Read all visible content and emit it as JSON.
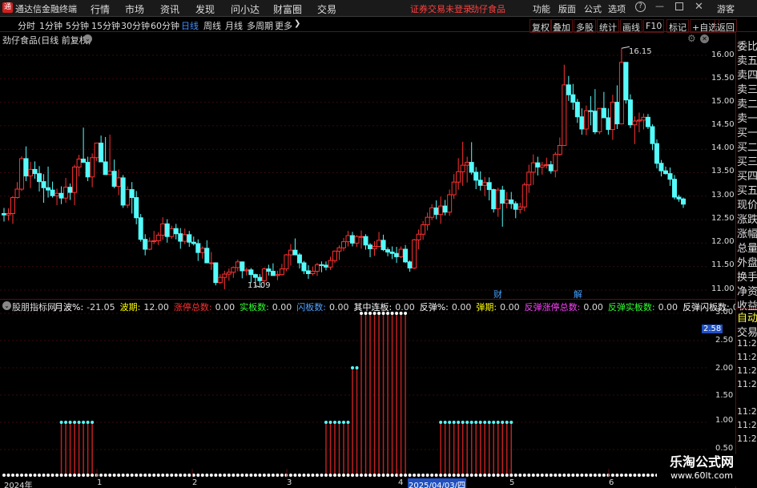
{
  "menubar": {
    "app_title": "通达信金融终端",
    "menus": [
      "行情",
      "市场",
      "资讯",
      "发现",
      "问小达",
      "财富圈",
      "交易"
    ],
    "status_text": "证券交易未登录",
    "stock_name": "劲仔食品",
    "right_menus": [
      "功能",
      "版面",
      "公式",
      "选项"
    ],
    "user": "游客"
  },
  "periods": [
    "分时",
    "1分钟",
    "5分钟",
    "15分钟",
    "30分钟",
    "60分钟",
    "日线",
    "周线",
    "月线",
    "多周期",
    "更多"
  ],
  "active_period": "日线",
  "toolbar_right": [
    "复权",
    "叠加",
    "多股",
    "统计",
    "画线",
    "F10",
    "标记",
    "+自选",
    "返回"
  ],
  "main_chart": {
    "title": "劲仔食品(日线 前复权)",
    "high_label": "16.15",
    "low_label": "11.09",
    "ylabels": [
      "16.00",
      "15.50",
      "15.00",
      "14.50",
      "14.00",
      "13.50",
      "13.00",
      "12.50",
      "12.00",
      "11.50",
      "11.00"
    ],
    "markers": [
      "财",
      "解"
    ]
  },
  "indicator": {
    "name": "股朋指标网",
    "items": [
      {
        "label": "月波%:",
        "value": "-21.05",
        "color": "#ffffff"
      },
      {
        "label": "波期:",
        "value": "12.00",
        "color": "#ffff00"
      },
      {
        "label": "涨停总数:",
        "value": "0.00",
        "color": "#ff3030"
      },
      {
        "label": "实板数:",
        "value": "0.00",
        "color": "#30ff30"
      },
      {
        "label": "闪板数:",
        "value": "0.00",
        "color": "#50a0ff"
      },
      {
        "label": "其中连板:",
        "value": "0.00",
        "color": "#ffffff"
      },
      {
        "label": "反弹%:",
        "value": "0.00",
        "color": "#ffffff"
      },
      {
        "label": "弹期:",
        "value": "0.00",
        "color": "#ffff00"
      },
      {
        "label": "反弹涨停总数:",
        "value": "0.00",
        "color": "#ff40ff"
      },
      {
        "label": "反弹实板数:",
        "value": "0.00",
        "color": "#30ff30"
      },
      {
        "label": "反弹闪板数:",
        "value": "0.00",
        "color": "#ffffff"
      },
      {
        "label": "其中反弹连板:",
        "value": "0.00",
        "color": "#ffffff"
      }
    ],
    "ylabels": [
      "3.00",
      "2.50",
      "2.00",
      "1.50",
      "1.00",
      "0.50"
    ],
    "current_value": "2.58"
  },
  "xaxis": [
    "2024年",
    "1",
    "2",
    "3",
    "4",
    "2025/04/03/四",
    "5",
    "6"
  ],
  "right_panel": [
    "委比",
    "卖五",
    "卖四",
    "卖三",
    "卖二",
    "卖一",
    "买一",
    "买二",
    "买三",
    "买四",
    "买五",
    "现价",
    "涨跌",
    "涨幅",
    "总量",
    "外盘",
    "换手",
    "净资",
    "收益"
  ],
  "right_panel2": [
    "自动",
    "交易"
  ],
  "right_times": [
    "11:26",
    "11:26",
    "11:26",
    "11:26",
    "11:28",
    "11:28",
    "11:28"
  ],
  "watermark": {
    "title": "乐淘公式网",
    "url": "www.60lt.com"
  },
  "colors": {
    "up": "#ff3232",
    "down": "#54fcfc",
    "bar": "#c02020",
    "dot": "#ffffff",
    "dot_cyan": "#54fcfc",
    "accent": "#ff2020"
  },
  "chart_data": {
    "type": "candlestick",
    "ylim": [
      10.85,
      16.35
    ],
    "candles": [
      [
        12.63,
        12.75,
        12.46,
        12.6
      ],
      [
        12.6,
        12.74,
        12.48,
        12.63
      ],
      [
        12.63,
        13.0,
        12.41,
        12.97
      ],
      [
        12.97,
        13.3,
        12.95,
        13.15
      ],
      [
        13.15,
        13.85,
        13.11,
        13.8
      ],
      [
        13.8,
        14.06,
        13.32,
        13.43
      ],
      [
        13.43,
        13.73,
        13.17,
        13.57
      ],
      [
        13.57,
        13.74,
        13.37,
        13.48
      ],
      [
        13.48,
        13.64,
        13.1,
        13.31
      ],
      [
        13.31,
        13.47,
        12.86,
        13.18
      ],
      [
        13.18,
        13.63,
        12.97,
        13.13
      ],
      [
        13.13,
        13.31,
        12.97,
        13.01
      ],
      [
        13.01,
        13.16,
        12.81,
        13.06
      ],
      [
        13.06,
        13.21,
        12.83,
        12.96
      ],
      [
        12.96,
        13.39,
        12.86,
        13.19
      ],
      [
        13.19,
        13.27,
        12.92,
        13.08
      ],
      [
        13.08,
        13.67,
        12.81,
        13.62
      ],
      [
        13.62,
        13.88,
        13.42,
        13.79
      ],
      [
        13.79,
        14.46,
        13.74,
        13.72
      ],
      [
        13.72,
        13.84,
        13.32,
        13.41
      ],
      [
        13.41,
        13.91,
        13.19,
        13.82
      ],
      [
        13.82,
        14.13,
        13.75,
        14.13
      ],
      [
        14.13,
        14.29,
        13.84,
        13.73
      ],
      [
        13.73,
        14.26,
        13.68,
        13.46
      ],
      [
        13.46,
        14.31,
        13.46,
        13.53
      ],
      [
        13.53,
        13.78,
        13.17,
        13.21
      ],
      [
        13.21,
        13.57,
        13.02,
        13.39
      ],
      [
        13.39,
        13.45,
        12.75,
        12.81
      ],
      [
        12.81,
        13.21,
        12.75,
        13.14
      ],
      [
        13.14,
        13.3,
        12.63,
        12.97
      ],
      [
        12.97,
        13.11,
        12.4,
        12.54
      ],
      [
        12.54,
        12.62,
        12.03,
        12.08
      ],
      [
        12.08,
        12.19,
        11.74,
        11.87
      ],
      [
        11.87,
        12.12,
        11.85,
        12.04
      ],
      [
        12.04,
        12.26,
        11.98,
        12.05
      ],
      [
        12.05,
        12.23,
        11.96,
        12.17
      ],
      [
        12.17,
        12.55,
        12.07,
        12.41
      ],
      [
        12.41,
        12.51,
        12.01,
        12.14
      ],
      [
        12.14,
        12.37,
        12.09,
        12.31
      ],
      [
        12.31,
        12.41,
        12.08,
        12.2
      ],
      [
        12.2,
        12.32,
        11.88,
        12.04
      ],
      [
        12.04,
        12.31,
        11.98,
        12.18
      ],
      [
        12.18,
        12.26,
        11.92,
        12.02
      ],
      [
        12.02,
        12.14,
        11.95,
        11.99
      ],
      [
        11.99,
        12.08,
        11.62,
        11.8
      ],
      [
        11.8,
        11.93,
        11.67,
        11.89
      ],
      [
        11.89,
        12.06,
        11.63,
        11.58
      ],
      [
        11.58,
        11.81,
        11.43,
        11.58
      ],
      [
        11.58,
        11.59,
        11.1,
        11.16
      ],
      [
        11.16,
        11.34,
        11.13,
        11.27
      ],
      [
        11.27,
        11.41,
        11.02,
        11.34
      ],
      [
        11.34,
        11.46,
        11.2,
        11.38
      ],
      [
        11.38,
        11.5,
        11.26,
        11.48
      ],
      [
        11.48,
        11.65,
        11.4,
        11.6
      ],
      [
        11.6,
        11.61,
        11.25,
        11.41
      ],
      [
        11.41,
        11.48,
        11.31,
        11.43
      ],
      [
        11.43,
        11.47,
        11.15,
        11.33
      ],
      [
        11.33,
        11.35,
        11.09,
        11.27
      ],
      [
        11.27,
        11.34,
        11.09,
        11.2
      ],
      [
        11.2,
        11.48,
        11.15,
        11.45
      ],
      [
        11.45,
        11.54,
        11.31,
        11.4
      ],
      [
        11.4,
        11.57,
        11.31,
        11.31
      ],
      [
        11.31,
        11.41,
        11.21,
        11.33
      ],
      [
        11.33,
        11.56,
        11.31,
        11.45
      ],
      [
        11.45,
        11.77,
        11.4,
        11.75
      ],
      [
        11.75,
        11.98,
        11.52,
        11.85
      ],
      [
        11.85,
        12.1,
        11.79,
        11.75
      ],
      [
        11.75,
        11.79,
        11.46,
        11.58
      ],
      [
        11.58,
        11.62,
        11.34,
        11.41
      ],
      [
        11.41,
        11.53,
        11.24,
        11.35
      ],
      [
        11.35,
        11.5,
        11.31,
        11.4
      ],
      [
        11.4,
        11.58,
        11.3,
        11.54
      ],
      [
        11.54,
        11.61,
        11.38,
        11.53
      ],
      [
        11.53,
        11.61,
        11.42,
        11.49
      ],
      [
        11.49,
        11.71,
        11.43,
        11.63
      ],
      [
        11.63,
        11.84,
        11.58,
        11.83
      ],
      [
        11.83,
        11.95,
        11.64,
        11.9
      ],
      [
        11.9,
        12.11,
        11.83,
        12.03
      ],
      [
        12.03,
        12.26,
        11.93,
        12.16
      ],
      [
        12.16,
        12.24,
        11.93,
        12.0
      ],
      [
        12.0,
        12.17,
        11.92,
        12.14
      ],
      [
        12.14,
        12.27,
        11.88,
        12.14
      ],
      [
        12.14,
        12.19,
        11.86,
        11.96
      ],
      [
        11.96,
        12.0,
        11.7,
        11.88
      ],
      [
        11.88,
        12.04,
        11.73,
        11.93
      ],
      [
        11.93,
        12.24,
        11.93,
        12.06
      ],
      [
        12.06,
        12.18,
        11.83,
        11.86
      ],
      [
        11.86,
        11.91,
        11.72,
        11.81
      ],
      [
        11.81,
        11.93,
        11.66,
        11.78
      ],
      [
        11.78,
        11.92,
        11.58,
        11.71
      ],
      [
        11.71,
        11.93,
        11.68,
        11.87
      ],
      [
        11.87,
        11.96,
        11.58,
        11.6
      ],
      [
        11.6,
        11.63,
        11.39,
        11.47
      ],
      [
        11.47,
        12.09,
        11.45,
        12.07
      ],
      [
        12.07,
        12.29,
        11.87,
        12.19
      ],
      [
        12.19,
        12.47,
        12.07,
        12.39
      ],
      [
        12.39,
        12.65,
        12.27,
        12.55
      ],
      [
        12.55,
        12.83,
        12.49,
        12.75
      ],
      [
        12.75,
        12.91,
        12.51,
        12.61
      ],
      [
        12.61,
        12.99,
        12.41,
        12.79
      ],
      [
        12.79,
        12.92,
        12.59,
        12.66
      ],
      [
        12.66,
        13.14,
        12.58,
        13.03
      ],
      [
        13.03,
        13.47,
        12.94,
        13.3
      ],
      [
        13.3,
        13.81,
        13.14,
        13.52
      ],
      [
        13.52,
        14.16,
        13.22,
        13.66
      ],
      [
        13.66,
        13.84,
        13.29,
        13.72
      ],
      [
        13.72,
        14.15,
        13.46,
        13.51
      ],
      [
        13.51,
        13.62,
        13.15,
        13.34
      ],
      [
        13.34,
        13.53,
        13.12,
        13.23
      ],
      [
        13.23,
        13.41,
        13.0,
        13.29
      ],
      [
        13.29,
        13.4,
        12.91,
        13.14
      ],
      [
        13.14,
        13.16,
        12.65,
        12.73
      ],
      [
        12.73,
        13.18,
        12.56,
        13.13
      ],
      [
        13.13,
        13.22,
        12.35,
        12.85
      ],
      [
        12.85,
        13.09,
        12.74,
        12.92
      ],
      [
        12.92,
        13.09,
        12.73,
        12.84
      ],
      [
        12.84,
        12.89,
        12.53,
        12.72
      ],
      [
        12.72,
        12.86,
        12.63,
        12.77
      ],
      [
        12.77,
        13.29,
        12.68,
        13.24
      ],
      [
        13.24,
        13.67,
        13.07,
        13.51
      ],
      [
        13.51,
        13.89,
        13.24,
        13.71
      ],
      [
        13.71,
        13.84,
        13.44,
        13.62
      ],
      [
        13.62,
        13.73,
        13.46,
        13.66
      ],
      [
        13.66,
        13.82,
        13.59,
        13.67
      ],
      [
        13.67,
        13.75,
        13.48,
        13.54
      ],
      [
        13.54,
        13.94,
        13.4,
        13.89
      ],
      [
        13.89,
        14.25,
        13.86,
        14.08
      ],
      [
        14.08,
        15.8,
        14.07,
        15.37
      ],
      [
        15.37,
        15.56,
        15.03,
        15.16
      ],
      [
        15.16,
        15.39,
        14.84,
        15.0
      ],
      [
        15.0,
        15.07,
        14.56,
        14.69
      ],
      [
        14.69,
        14.87,
        14.31,
        14.43
      ],
      [
        14.43,
        14.93,
        14.3,
        14.82
      ],
      [
        14.82,
        15.13,
        14.51,
        14.81
      ],
      [
        14.81,
        15.28,
        14.32,
        14.37
      ],
      [
        14.37,
        14.87,
        14.32,
        14.87
      ],
      [
        14.87,
        15.22,
        14.68,
        14.67
      ],
      [
        14.67,
        14.87,
        14.31,
        14.42
      ],
      [
        14.42,
        15.16,
        14.2,
        15.0
      ],
      [
        15.0,
        15.36,
        14.43,
        14.54
      ],
      [
        14.54,
        16.15,
        14.53,
        15.85
      ],
      [
        15.85,
        15.71,
        14.97,
        15.05
      ],
      [
        15.05,
        15.17,
        14.45,
        14.52
      ],
      [
        14.52,
        14.7,
        14.11,
        14.6
      ],
      [
        14.6,
        14.78,
        14.36,
        14.62
      ],
      [
        14.62,
        14.76,
        14.42,
        14.68
      ],
      [
        14.68,
        14.75,
        14.43,
        14.48
      ],
      [
        14.48,
        14.53,
        13.98,
        14.12
      ],
      [
        14.12,
        14.21,
        13.59,
        13.7
      ],
      [
        13.7,
        13.77,
        13.42,
        13.54
      ],
      [
        13.54,
        13.63,
        13.46,
        13.48
      ],
      [
        13.48,
        13.61,
        13.22,
        13.36
      ],
      [
        13.36,
        13.45,
        12.93,
        12.98
      ],
      [
        12.98,
        13.03,
        12.88,
        12.94
      ],
      [
        12.94,
        12.97,
        12.75,
        12.83
      ]
    ],
    "ind_values": [
      0,
      0,
      0,
      0,
      0,
      0,
      0,
      0,
      0,
      0,
      0,
      0,
      0,
      0,
      0,
      0,
      0,
      0,
      0,
      0,
      0,
      0,
      0,
      0,
      0,
      0,
      0,
      0,
      0,
      0,
      0,
      0,
      0,
      0,
      0,
      0,
      0,
      0,
      0,
      0,
      0,
      0,
      0,
      0,
      0,
      0,
      0,
      0,
      0,
      0,
      0,
      0,
      0,
      0,
      0,
      0,
      0,
      0,
      0,
      0,
      0,
      0,
      0,
      0,
      0,
      0,
      0,
      0,
      0,
      0,
      0,
      0,
      0,
      0,
      0,
      0,
      0,
      0,
      0,
      0,
      0,
      0,
      0,
      0,
      0,
      0,
      0,
      0,
      0,
      0,
      0,
      0,
      0,
      0,
      0,
      0,
      0,
      0,
      0,
      0,
      0,
      0,
      0,
      0,
      0,
      0,
      0,
      0,
      0,
      0,
      0,
      0,
      0,
      0,
      0,
      0,
      0,
      0,
      0,
      0,
      0,
      0,
      0,
      0,
      0,
      0,
      0,
      0,
      0,
      0,
      0,
      0,
      0,
      0,
      0,
      0,
      0,
      0,
      0,
      0,
      0,
      0,
      0,
      0,
      0,
      0,
      0,
      0,
      0
    ],
    "ind_segments": [
      {
        "from": 13,
        "to": 20,
        "value": 1
      },
      {
        "from": 73,
        "to": 78,
        "value": 1
      },
      {
        "from": 79,
        "to": 80,
        "value": 2
      },
      {
        "from": 81,
        "to": 91,
        "value": 3
      },
      {
        "from": 99,
        "to": 115,
        "value": 1
      }
    ]
  }
}
